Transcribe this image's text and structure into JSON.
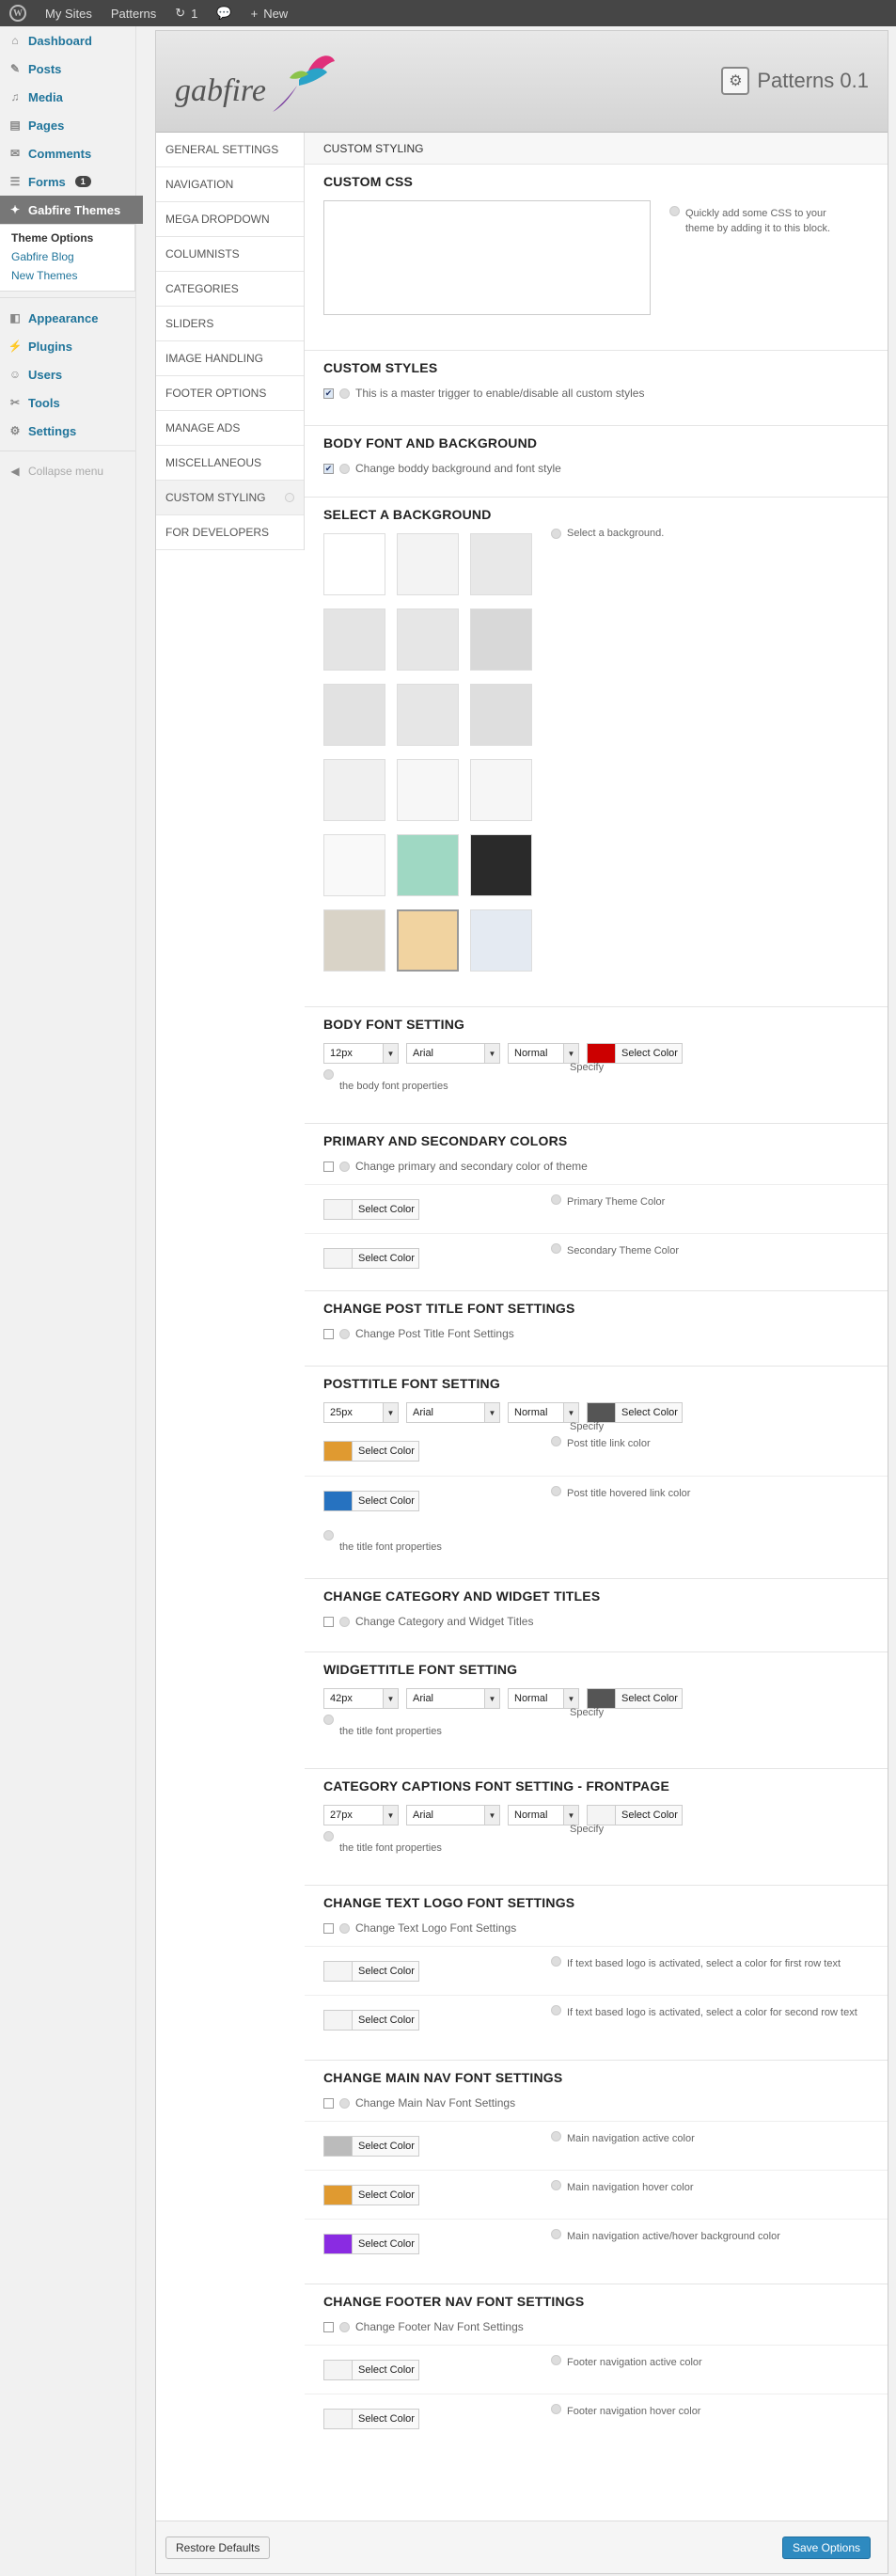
{
  "adminbar": {
    "my_sites": "My Sites",
    "site": "Patterns",
    "updates": "1",
    "new": "New"
  },
  "sidebar": {
    "items": [
      {
        "label": "Dashboard",
        "icon": "dashboard-icon"
      },
      {
        "label": "Posts",
        "icon": "pin-icon"
      },
      {
        "label": "Media",
        "icon": "media-icon"
      },
      {
        "label": "Pages",
        "icon": "pages-icon"
      },
      {
        "label": "Comments",
        "icon": "comments-icon"
      },
      {
        "label": "Forms",
        "icon": "forms-icon",
        "badge": "1"
      },
      {
        "label": "Gabfire Themes",
        "icon": "gabfire-icon"
      }
    ],
    "submenu": [
      "Theme Options",
      "Gabfire Blog",
      "New Themes"
    ],
    "items2": [
      {
        "label": "Appearance",
        "icon": "appearance-icon"
      },
      {
        "label": "Plugins",
        "icon": "plugins-icon"
      },
      {
        "label": "Users",
        "icon": "users-icon"
      },
      {
        "label": "Tools",
        "icon": "tools-icon"
      },
      {
        "label": "Settings",
        "icon": "settings-icon"
      }
    ],
    "collapse": "Collapse menu"
  },
  "header": {
    "logo_text": "gabfire",
    "title": "Patterns 0.1"
  },
  "nav": [
    "GENERAL SETTINGS",
    "NAVIGATION",
    "MEGA DROPDOWN",
    "COLUMNISTS",
    "CATEGORIES",
    "SLIDERS",
    "IMAGE HANDLING",
    "FOOTER OPTIONS",
    "MANAGE ADS",
    "MISCELLANEOUS",
    "CUSTOM STYLING",
    "FOR DEVELOPERS"
  ],
  "tab": "CUSTOM STYLING",
  "select_color": "Select Color",
  "specify": "Specify",
  "sections": {
    "custom_css": {
      "title": "CUSTOM CSS",
      "hint": "Quickly add some CSS to your theme by adding it to this block."
    },
    "custom_styles": {
      "title": "CUSTOM STYLES",
      "check": "This is a master trigger to enable/disable all custom styles"
    },
    "body_bg": {
      "title": "BODY FONT AND BACKGROUND",
      "check": "Change boddy background and font style"
    },
    "select_bg": {
      "title": "SELECT A BACKGROUND",
      "hint": "Select a background.",
      "tiles": [
        "#ffffff",
        "#f3f3f3",
        "#e8e8e8",
        "#e4e4e4",
        "#e6e6e6",
        "#d8d8d8",
        "#e2e2e2",
        "#e6e6e6",
        "#dedede",
        "#f0f0f0",
        "#f7f7f7",
        "#f6f6f6",
        "#f9f9f9",
        "#9fd8c3",
        "#2a2a2a",
        "#d9d3c7",
        "#f1d3a0",
        "#e4eaf2"
      ]
    },
    "body_font": {
      "title": "BODY FONT SETTING",
      "size": "12px",
      "face": "Arial",
      "weight": "Normal",
      "color": "#cc0000",
      "props": "the body font properties"
    },
    "primary": {
      "title": "PRIMARY AND SECONDARY COLORS",
      "check": "Change primary and secondary color of theme",
      "primary": "Primary Theme Color",
      "secondary": "Secondary Theme Color",
      "primary_color": "#f4f4f4",
      "secondary_color": "#f4f4f4"
    },
    "post_title": {
      "title": "CHANGE POST TITLE FONT SETTINGS",
      "check": "Change Post Title Font Settings"
    },
    "posttitle_font": {
      "title": "POSTTITLE FONT SETTING",
      "size": "25px",
      "face": "Arial",
      "weight": "Normal",
      "color": "#555555",
      "props": "the title font properties",
      "link": "Post title link color",
      "link_color": "#e09a30",
      "hover": "Post title hovered link color",
      "hover_color": "#2672c0"
    },
    "cat_widget": {
      "title": "CHANGE CATEGORY AND WIDGET TITLES",
      "check": "Change Category and Widget Titles"
    },
    "widget_font": {
      "title": "WIDGETTITLE FONT SETTING",
      "size": "42px",
      "face": "Arial",
      "weight": "Normal",
      "color": "#555555",
      "props": "the title font properties"
    },
    "cat_captions": {
      "title": "CATEGORY CAPTIONS FONT SETTING - FRONTPAGE",
      "size": "27px",
      "face": "Arial",
      "weight": "Normal",
      "color": "#f4f4f4",
      "props": "the title font properties"
    },
    "text_logo": {
      "title": "CHANGE TEXT LOGO FONT SETTINGS",
      "check": "Change Text Logo Font Settings",
      "first": "If text based logo is activated, select a color for first row text",
      "second": "If text based logo is activated, select a color for second row text",
      "first_color": "#f4f4f4",
      "second_color": "#f4f4f4"
    },
    "main_nav": {
      "title": "CHANGE MAIN NAV FONT SETTINGS",
      "check": "Change Main Nav Font Settings",
      "active": "Main navigation active color",
      "hover": "Main navigation hover color",
      "bg": "Main navigation active/hover background color",
      "active_color": "#bbbbbb",
      "hover_color": "#e09a30",
      "bg_color": "#8a2be2"
    },
    "footer_nav": {
      "title": "CHANGE FOOTER NAV FONT SETTINGS",
      "check": "Change Footer Nav Font Settings",
      "active": "Footer navigation active color",
      "hover": "Footer navigation hover color",
      "active_color": "#f4f4f4",
      "hover_color": "#f4f4f4"
    }
  },
  "footer": {
    "restore": "Restore Defaults",
    "save": "Save Options"
  }
}
